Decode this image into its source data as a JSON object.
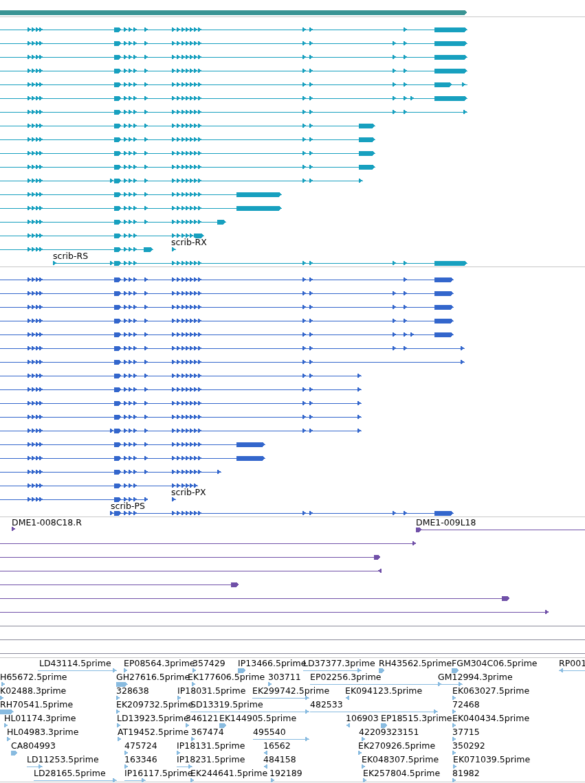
{
  "tracks": [
    {
      "color": "#17a0bf",
      "labels": [
        "scrib-RX",
        "scrib-RS"
      ]
    },
    {
      "color": "#3366cc",
      "labels": [
        "scrib-PX",
        "scrib-PS"
      ]
    },
    {
      "color": "#7050a8",
      "labels": [
        "DME1-008C18.R",
        "DME1-009L18"
      ]
    },
    {
      "color": "#88bbe0",
      "labels": [
        "LD43114.5prime",
        "EP08564.3prime",
        "357429",
        "IP13466.5prime",
        "LD37377.3prime",
        "RH43562.5prime",
        "FGM304C06.5prime",
        "RP001",
        "H65672.5prime",
        "GH27616.5prime",
        "EK177606.5prime",
        "303711",
        "EP02256.3prime",
        "GM12994.3prime",
        "K02488.3prime",
        "328638",
        "IP18031.5prime",
        "EK299742.5prime",
        "EK094123.5prime",
        "EK063027.5prime",
        "RH70541.5prime",
        "EK209732.5prime",
        "SD13319.5prime",
        "482533",
        "72468",
        "HL01174.3prime",
        "LD13923.5prime",
        "346121",
        "EK144905.5prime",
        "106903",
        "EP18515.3prime",
        "EK040434.5prime",
        "HL04983.3prime",
        "AT19452.5prime",
        "367474",
        "495540",
        "42209323151",
        "37715",
        "CA804993",
        "475724",
        "IP18131.5prime",
        "16562",
        "EK270926.5prime",
        "350292",
        "LD11253.5prime",
        "163346",
        "IP18231.5prime",
        "484158",
        "EK048307.5prime",
        "EK071039.5prime",
        "LD28165.5prime",
        "IP16117.5prime",
        "EK244641.5prime",
        "192189",
        "EK257804.5prime",
        "81982"
      ]
    }
  ]
}
